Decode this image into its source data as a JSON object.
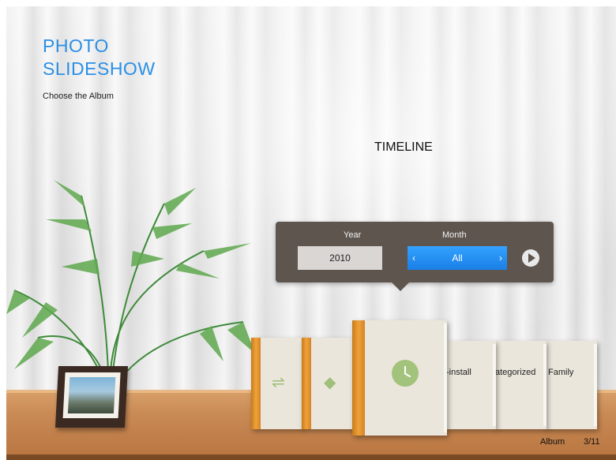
{
  "header": {
    "title_line1": "PHOTO",
    "title_line2": "SLIDESHOW",
    "subtitle": "Choose the Album"
  },
  "timeline": {
    "label": "TIMELINE",
    "year_header": "Year",
    "month_header": "Month",
    "year_value": "2010",
    "month_value": "All",
    "prev_glyph": "‹",
    "next_glyph": "›",
    "play_icon": "play-icon"
  },
  "albums": [
    {
      "label": "",
      "icon": "usb-icon"
    },
    {
      "label": "",
      "icon": "tag-icon"
    },
    {
      "label": "",
      "icon": "clock-icon"
    },
    {
      "label": "-install"
    },
    {
      "label": "ategorized"
    },
    {
      "label": "Family"
    }
  ],
  "footer": {
    "album_label": "Album",
    "album_count": "3/11"
  },
  "colors": {
    "accent_blue": "#2b8fe6",
    "month_highlight": "#1a7fe6",
    "panel": "#5e554f",
    "book_spine": "#f0a23a"
  }
}
